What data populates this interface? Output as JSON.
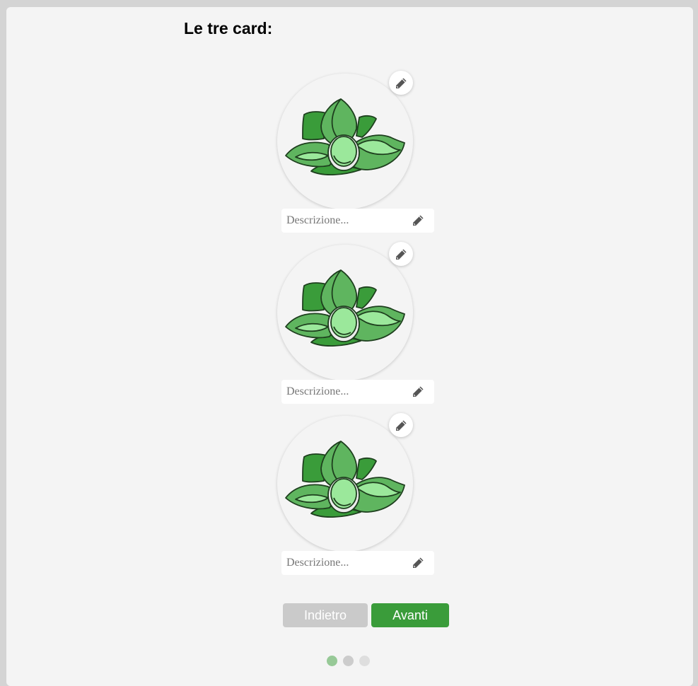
{
  "title": "Le tre card:",
  "cards": [
    {
      "description_placeholder": "Descrizione...",
      "description_value": "",
      "image_icon": "lotus-leaf-icon",
      "edit_icon": "pencil-icon"
    },
    {
      "description_placeholder": "Descrizione...",
      "description_value": "",
      "image_icon": "lotus-leaf-icon",
      "edit_icon": "pencil-icon"
    },
    {
      "description_placeholder": "Descrizione...",
      "description_value": "",
      "image_icon": "lotus-leaf-icon",
      "edit_icon": "pencil-icon"
    }
  ],
  "buttons": {
    "back_label": "Indietro",
    "next_label": "Avanti"
  },
  "pagination": {
    "total": 3,
    "current": 1
  },
  "colors": {
    "background": "#d4d4d4",
    "panel": "#f4f4f4",
    "primary_green": "#3a9c3a",
    "button_disabled": "#cacaca",
    "dot_active": "#97c997",
    "dot_inactive": "#cccccc",
    "dot_inactive_light": "#dedede"
  }
}
